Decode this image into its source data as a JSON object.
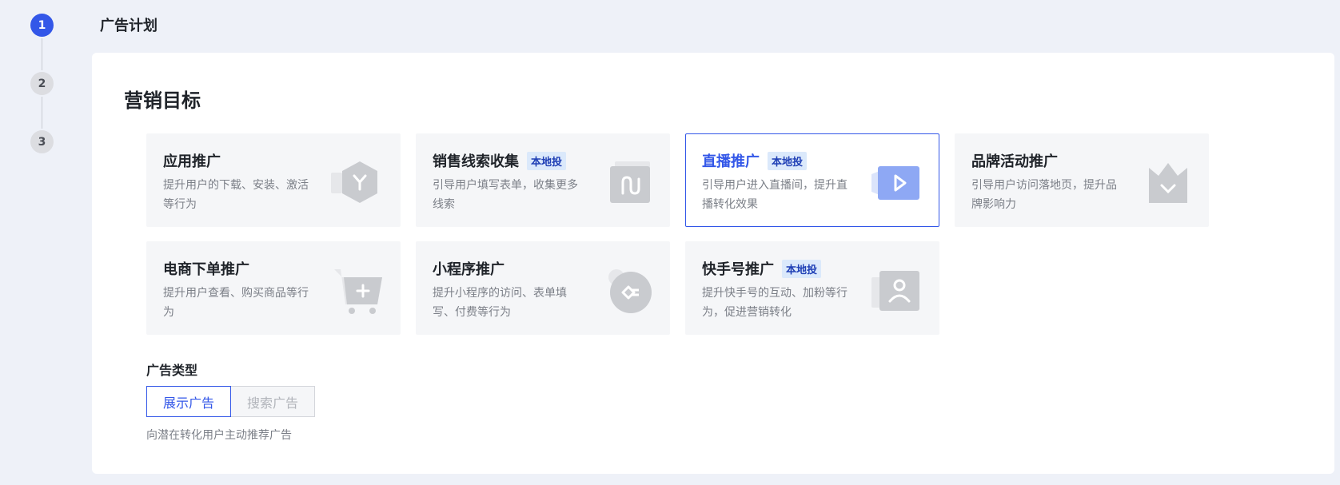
{
  "stepper": {
    "steps": [
      "1",
      "2",
      "3"
    ],
    "active_index": 0,
    "active_color": "#3357e8"
  },
  "page": {
    "title": "广告计划"
  },
  "marketing_goal": {
    "title": "营销目标",
    "selected_index": 2,
    "cards": [
      {
        "title": "应用推广",
        "badge": "",
        "desc": "提升用户的下载、安装、激活等行为",
        "icon": "hexagon-app-icon"
      },
      {
        "title": "销售线索收集",
        "badge": "本地投",
        "desc": "引导用户填写表单，收集更多线索",
        "icon": "folder-form-icon"
      },
      {
        "title": "直播推广",
        "badge": "本地投",
        "desc": "引导用户进入直播间，提升直播转化效果",
        "icon": "play-video-icon"
      },
      {
        "title": "品牌活动推广",
        "badge": "",
        "desc": "引导用户访问落地页，提升品牌影响力",
        "icon": "crown-brand-icon"
      },
      {
        "title": "电商下单推广",
        "badge": "",
        "desc": "提升用户查看、购买商品等行为",
        "icon": "shopping-cart-icon"
      },
      {
        "title": "小程序推广",
        "badge": "",
        "desc": "提升小程序的访问、表单填写、付费等行为",
        "icon": "mini-program-icon"
      },
      {
        "title": "快手号推广",
        "badge": "本地投",
        "desc": "提升快手号的互动、加粉等行为，促进营销转化",
        "icon": "user-account-icon"
      }
    ]
  },
  "ad_type": {
    "label": "广告类型",
    "options": [
      "展示广告",
      "搜索广告"
    ],
    "selected_index": 0,
    "hint": "向潜在转化用户主动推荐广告"
  }
}
